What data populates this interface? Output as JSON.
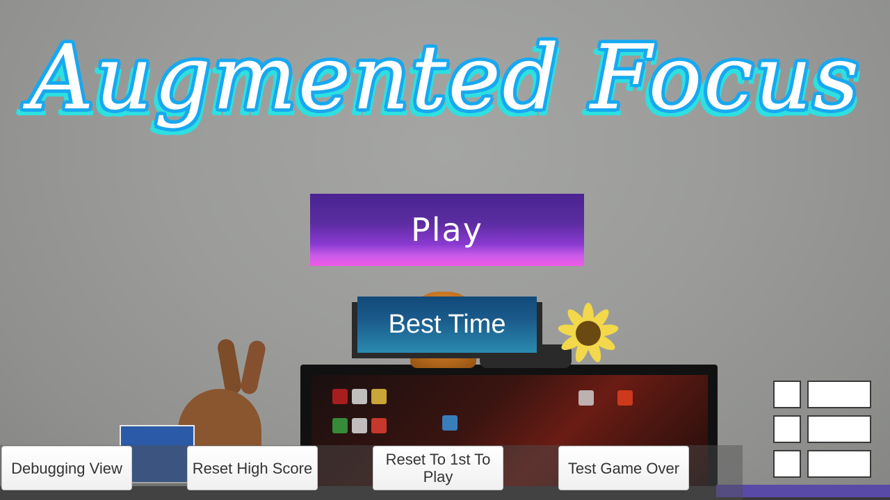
{
  "title": "Augmented Focus",
  "menu": {
    "play_label": "Play",
    "best_time_label": "Best Time"
  },
  "debug_bar": {
    "debugging_view": "Debugging View",
    "reset_high_score": "Reset High Score",
    "reset_first_to_play": "Reset To 1st To Play",
    "test_game_over": "Test Game Over"
  },
  "colors": {
    "title_outline": "#18a8f0",
    "play_gradient_top": "#4a2490",
    "play_gradient_bottom": "#f05ae8",
    "best_time_top": "#124a7a",
    "best_time_bottom": "#2a8ab0"
  }
}
